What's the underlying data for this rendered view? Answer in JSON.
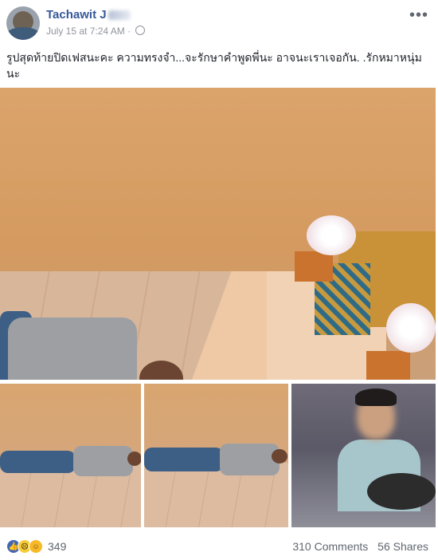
{
  "post": {
    "author_visible": "Tachawit J",
    "timestamp": "July 15 at 7:24 AM",
    "privacy_icon": "globe-icon",
    "more_icon": "more-options-icon",
    "more_label": "•••",
    "caption": "รูปสุดท้ายปิดเฟสนะคะ ความทรงจำ...จะรักษาคำพูดพี่นะ อาจนะเราเจอกัน. .รักหมาหนุ่มนะ"
  },
  "photos": [
    {
      "id": "main"
    },
    {
      "id": "thumb-1"
    },
    {
      "id": "thumb-2"
    },
    {
      "id": "thumb-3"
    }
  ],
  "footer": {
    "reaction_icons": [
      "like-icon",
      "sad-icon",
      "haha-icon"
    ],
    "reaction_count": "349",
    "comments": "310 Comments",
    "shares": "56 Shares"
  },
  "colors": {
    "link_blue": "#365899",
    "meta_gray": "#90949c",
    "text": "#1d2129"
  }
}
